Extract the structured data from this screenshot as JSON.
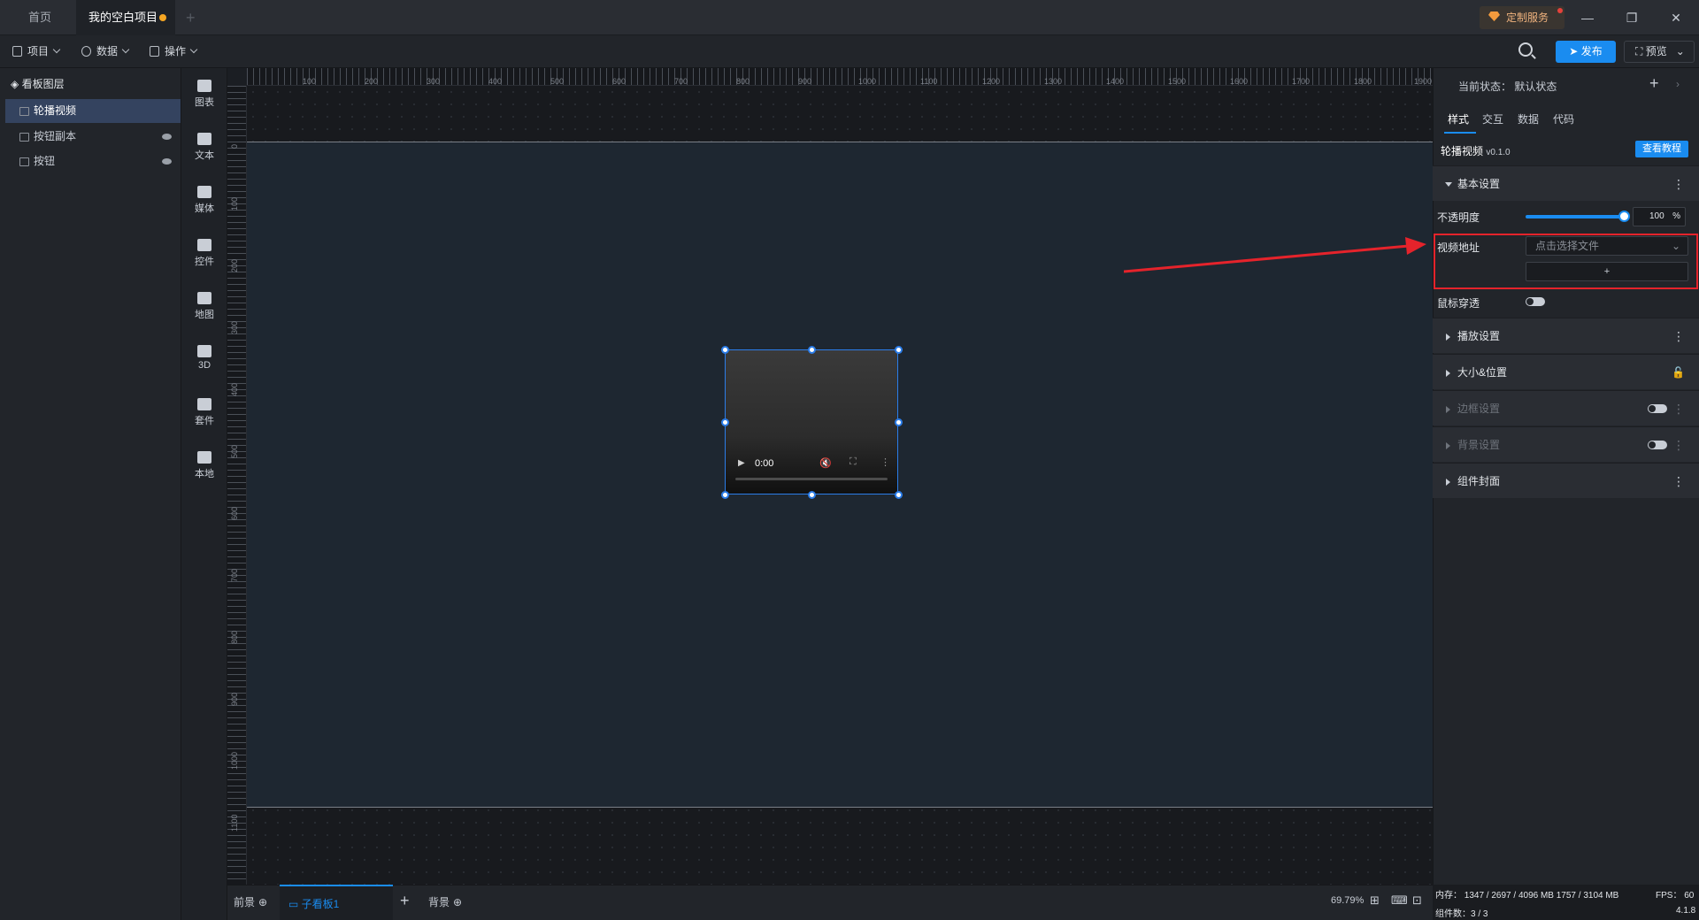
{
  "tabs": {
    "home": "首页",
    "project": "我的空白项目"
  },
  "service": "定制服务",
  "window": {
    "minimize": "—",
    "restore": "❐",
    "close": "✕"
  },
  "menu": {
    "project": "项目",
    "data": "数据",
    "ops": "操作"
  },
  "toolbar": {
    "publish": "发布",
    "preview": "预览"
  },
  "layers": {
    "title": "看板图层",
    "items": [
      "轮播视频",
      "按钮副本",
      "按钮"
    ]
  },
  "components": [
    "图表",
    "文本",
    "媒体",
    "控件",
    "地图",
    "3D",
    "套件",
    "本地"
  ],
  "ruler": {
    "h": [
      "100",
      "200",
      "300",
      "400",
      "500",
      "600",
      "700",
      "800",
      "900",
      "1000",
      "1100",
      "1200",
      "1300",
      "1400",
      "1500",
      "1600",
      "1700",
      "1800",
      "1900"
    ],
    "v": [
      "0",
      "100",
      "200",
      "300",
      "400",
      "500",
      "600",
      "700",
      "800",
      "900",
      "1000",
      "1100"
    ]
  },
  "video": {
    "time": "0:00"
  },
  "bottom": {
    "front": "前景",
    "sub": "子看板1",
    "back": "背景",
    "zoom": "69.79%"
  },
  "status": {
    "memory": "内存： 1347 / 2697 / 4096 MB  1757 / 3104 MB",
    "fps": "FPS： 60",
    "count": "组件数：3 / 3",
    "version": "4.1.8"
  },
  "right": {
    "state": "当前状态： 默认状态",
    "tabs": [
      "样式",
      "交互",
      "数据",
      "代码"
    ],
    "component": "轮播视频",
    "version": "v0.1.0",
    "tutorial": "查看教程",
    "basic": "基本设置",
    "opacity_label": "不透明度",
    "opacity": "100",
    "opacity_unit": "%",
    "video_label": "视频地址",
    "video_placeholder": "点击选择文件",
    "add": "+",
    "mouse_label": "鼠标穿透",
    "sections": [
      "播放设置",
      "大小&位置",
      "边框设置",
      "背景设置",
      "组件封面"
    ]
  },
  "colors": {
    "accent": "#1a8cf0",
    "highlight": "#e5232b"
  }
}
